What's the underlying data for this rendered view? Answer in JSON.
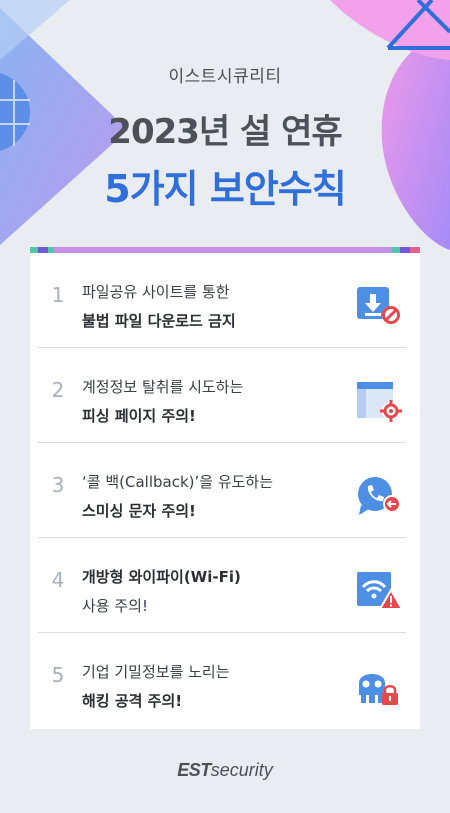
{
  "header": {
    "company": "이스트시큐리티",
    "title_line1": "2023년 설 연휴",
    "title_line2": "5가지 보안수칙"
  },
  "items": [
    {
      "number": "1",
      "line1": "파일공유 사이트를 통한",
      "line2": "불법 파일 다운로드 금지",
      "bold_line": 2,
      "icon": "download-block-icon"
    },
    {
      "number": "2",
      "line1": "계정정보 탈취를 시도하는",
      "line2": "피싱 페이지 주의!",
      "bold_line": 2,
      "icon": "phishing-target-icon"
    },
    {
      "number": "3",
      "line1": "‘콜 백(Callback)’을 유도하는",
      "line2": "스미싱 문자 주의!",
      "bold_line": 2,
      "icon": "phone-chat-icon"
    },
    {
      "number": "4",
      "line1": "개방형 와이파이(Wi-Fi)",
      "line2": "사용 주의!",
      "bold_line": 1,
      "icon": "wifi-warning-icon"
    },
    {
      "number": "5",
      "line1": "기업 기밀정보를 노리는",
      "line2": "해킹 공격 주의!",
      "bold_line": 2,
      "icon": "skull-lock-icon"
    }
  ],
  "footer": {
    "logo_est": "EST",
    "logo_security": "security"
  },
  "colors": {
    "accent_blue": "#2f6fdb",
    "icon_blue": "#4e8fe6",
    "icon_red": "#e5484d",
    "strip_purple": "#c690ea",
    "background": "#e9edf2"
  }
}
